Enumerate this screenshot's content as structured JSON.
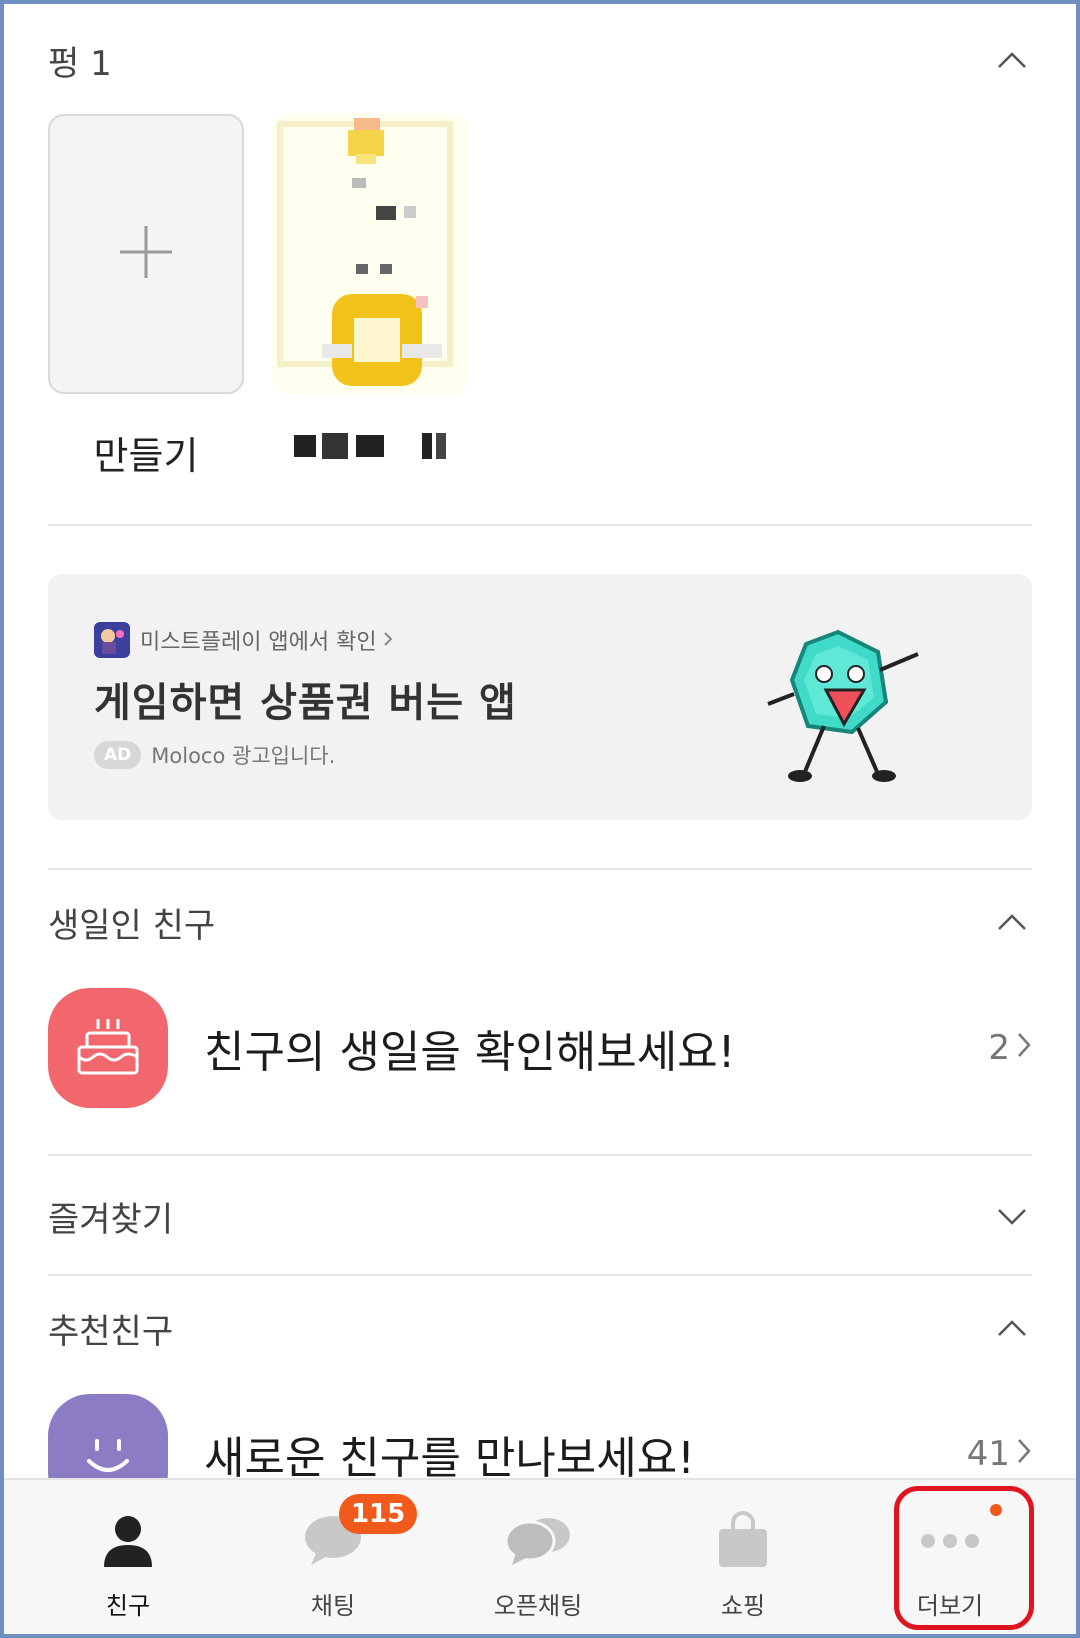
{
  "pung": {
    "title": "펑 1",
    "create_label": "만들기"
  },
  "ad": {
    "source": "미스트플레이 앱에서 확인",
    "title": "게임하면 상품권 버는 앱",
    "badge": "AD",
    "disclaimer": "Moloco 광고입니다."
  },
  "birthday": {
    "title": "생일인 친구",
    "text": "친구의 생일을 확인해보세요!",
    "count": "2"
  },
  "favorites": {
    "title": "즐겨찾기"
  },
  "recommended": {
    "title": "추천친구",
    "text": "새로운 친구를 만나보세요!",
    "count": "41"
  },
  "tabbar": {
    "friends": "친구",
    "chats": "채팅",
    "chats_badge": "115",
    "openchat": "오픈채팅",
    "shopping": "쇼핑",
    "more": "더보기"
  },
  "colors": {
    "accent_badge": "#f25a1c",
    "birthday_icon": "#f1676d",
    "recommend_icon": "#8c7cc3",
    "highlight": "#e0141e"
  }
}
